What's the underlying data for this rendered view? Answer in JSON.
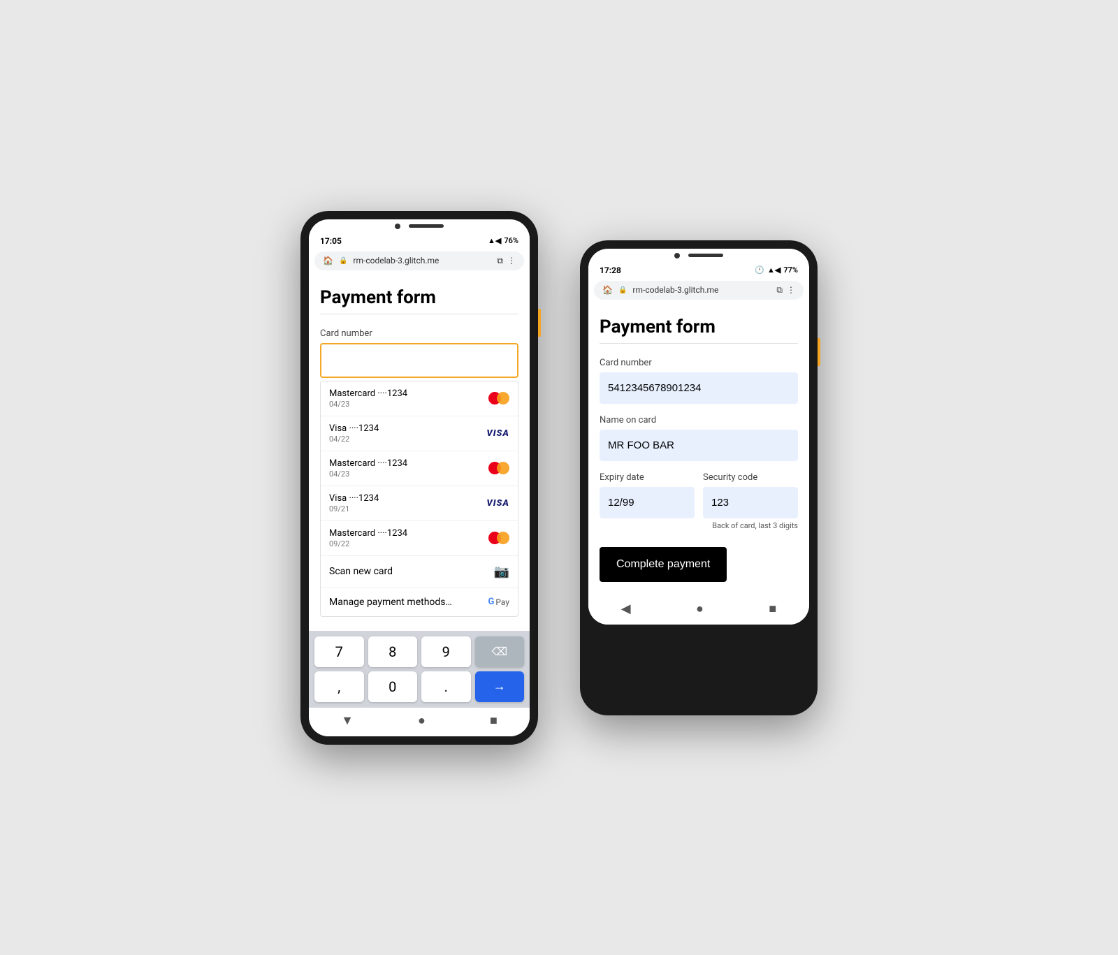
{
  "left_phone": {
    "status": {
      "time": "17:05",
      "battery": "76%",
      "signal": "▲◀",
      "battery_icon": "🔋"
    },
    "browser": {
      "url": "rm-codelab-3.glitch.me"
    },
    "page": {
      "title": "Payment form",
      "card_number_label": "Card number",
      "card_number_placeholder": ""
    },
    "autocomplete": {
      "items": [
        {
          "brand": "Mastercard",
          "dots": "····1234",
          "expiry": "04/23",
          "type": "mc"
        },
        {
          "brand": "Visa",
          "dots": "····1234",
          "expiry": "04/22",
          "type": "visa"
        },
        {
          "brand": "Mastercard",
          "dots": "····1234",
          "expiry": "04/23",
          "type": "mc"
        },
        {
          "brand": "Visa",
          "dots": "····1234",
          "expiry": "09/21",
          "type": "visa"
        },
        {
          "brand": "Mastercard",
          "dots": "····1234",
          "expiry": "09/22",
          "type": "mc"
        }
      ],
      "scan_label": "Scan new card",
      "manage_label": "Manage payment methods…"
    },
    "keyboard": {
      "rows": [
        [
          "7",
          "8",
          "9",
          "⌫"
        ],
        [
          ",",
          "0",
          ".",
          "→"
        ]
      ]
    }
  },
  "right_phone": {
    "status": {
      "time": "17:28",
      "battery": "77%"
    },
    "browser": {
      "url": "rm-codelab-3.glitch.me"
    },
    "page": {
      "title": "Payment form",
      "card_number_label": "Card number",
      "card_number_value": "5412345678901234",
      "name_label": "Name on card",
      "name_value": "MR FOO BAR",
      "expiry_label": "Expiry date",
      "expiry_value": "12/99",
      "security_label": "Security code",
      "security_value": "123",
      "security_hint": "Back of card, last 3 digits",
      "submit_label": "Complete payment"
    }
  }
}
